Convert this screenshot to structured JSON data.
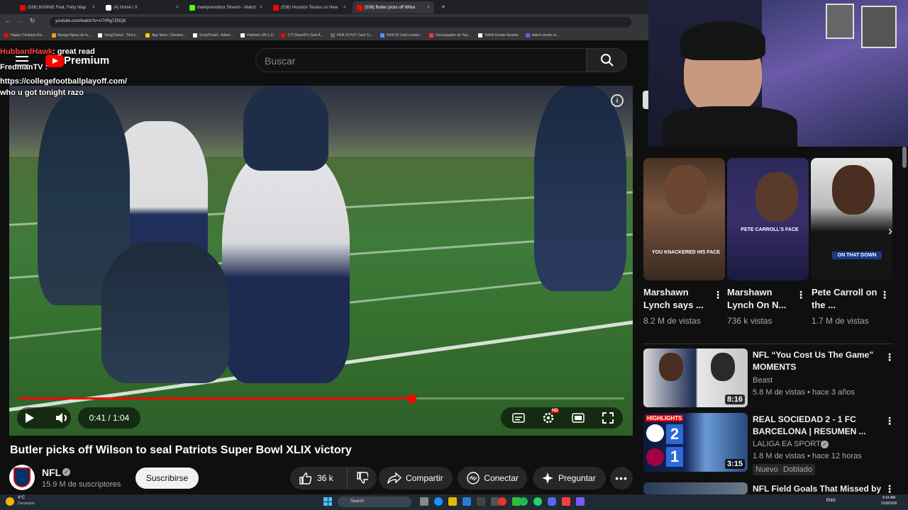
{
  "browser": {
    "tabs": [
      {
        "label": "(536) 6IX9INE Feat. Fetty Wap",
        "color": "#ff0000"
      },
      {
        "label": "(4) Home / X",
        "color": "#ffffff"
      },
      {
        "label": "markynextdoor Stream - Watch",
        "color": "#53fc18"
      },
      {
        "label": "(536) Houston Texans vs New",
        "color": "#ff0000"
      },
      {
        "label": "(536) Butler picks off Wilso",
        "color": "#ff0000"
      }
    ],
    "url": "youtube.com/watch?v=U7rPlg7ZNQ8",
    "bookmarks": [
      {
        "label": "Happy Cristiano Ro...",
        "color": "#ff0000"
      },
      {
        "label": "Burago figura de to...",
        "color": "#ff9900"
      },
      {
        "label": "SongTrivia2 - Test y...",
        "color": "#ffffff"
      },
      {
        "label": "App Store / Streami...",
        "color": "#ffcc00"
      },
      {
        "label": "SongTrivia2 - Adivin...",
        "color": "#ffffff"
      },
      {
        "label": "Paletool v25.1.11",
        "color": "#ffffff"
      },
      {
        "label": "(77) Razo97s Zest-A...",
        "color": "#ff0000"
      },
      {
        "label": "FIFA 23 FUT Card Cr...",
        "color": "#666666"
      },
      {
        "label": "FIFA 23 Card creator...",
        "color": "#4c9aff"
      },
      {
        "label": "Descargador de You...",
        "color": "#ff3333"
      },
      {
        "label": "Twitch Emote Resizer",
        "color": "#ffffff"
      },
      {
        "label": "twitch emote re...",
        "color": "#9146ff"
      }
    ]
  },
  "youtube": {
    "logo_text": "Premium",
    "search_placeholder": "Buscar"
  },
  "chat": [
    {
      "user": "HubbardHawk",
      "text": ": great read",
      "color": "#ff4444"
    },
    {
      "user": "FredmanTV",
      "text": ":",
      "color": "#ffffff"
    },
    {
      "user": "",
      "text": "https://collegefootballplayoff.com/",
      "color": "#ffffff"
    },
    {
      "user": "",
      "text": "who u got tonight razo",
      "color": "#ffffff"
    }
  ],
  "video": {
    "current_time": "0:41",
    "duration": "1:04",
    "time_display": "0:41 / 1:04",
    "progress": 0.65,
    "hd_badge": "HD",
    "title": "Butler picks off Wilson to seal Patriots Super Bowl XLIX victory"
  },
  "channel": {
    "name": "NFL",
    "subscribers": "15.9 M de suscriptores",
    "subscribe_label": "Suscribirse"
  },
  "actions": {
    "likes": "36 k",
    "share": "Compartir",
    "connect": "Conectar",
    "ask": "Preguntar"
  },
  "shorts": [
    {
      "title": "Marshawn Lynch says ...",
      "views": "8.2 M de vistas",
      "overlay": "YOU KNACKERED HIS FACE"
    },
    {
      "title": "Marshawn Lynch On N...",
      "views": "736 k vistas",
      "overlay": "PETE CARROLL'S FACE"
    },
    {
      "title": "Pete Carroll on the ...",
      "views": "1.7 M de vistas",
      "overlay": "ON THAT DOWN"
    }
  ],
  "related": [
    {
      "title": "NFL “You Cost Us The Game” MOMENTS",
      "channel": "Beast",
      "meta": "5.8 M de vistas • hace 3 años",
      "duration": "8:16"
    },
    {
      "title": "REAL SOCIEDAD 2 - 1 FC BARCELONA | RESUMEN ...",
      "channel": "LALIGA EA SPORTS",
      "meta": "1.8 M de vistas • hace 12 horas",
      "duration": "3:15",
      "badge_new": "Nuevo",
      "badge_dub": "Doblado",
      "thumb_tag": "HIGHLIGHTS"
    },
    {
      "title": "NFL Field Goals That Missed by",
      "channel": "",
      "meta": "",
      "duration": ""
    }
  ],
  "taskbar": {
    "weather": "4°C",
    "weather_sub": "Despejado",
    "search": "Search",
    "lang": "ENG",
    "time": "4:16 AM",
    "date": "1/18/2026"
  }
}
